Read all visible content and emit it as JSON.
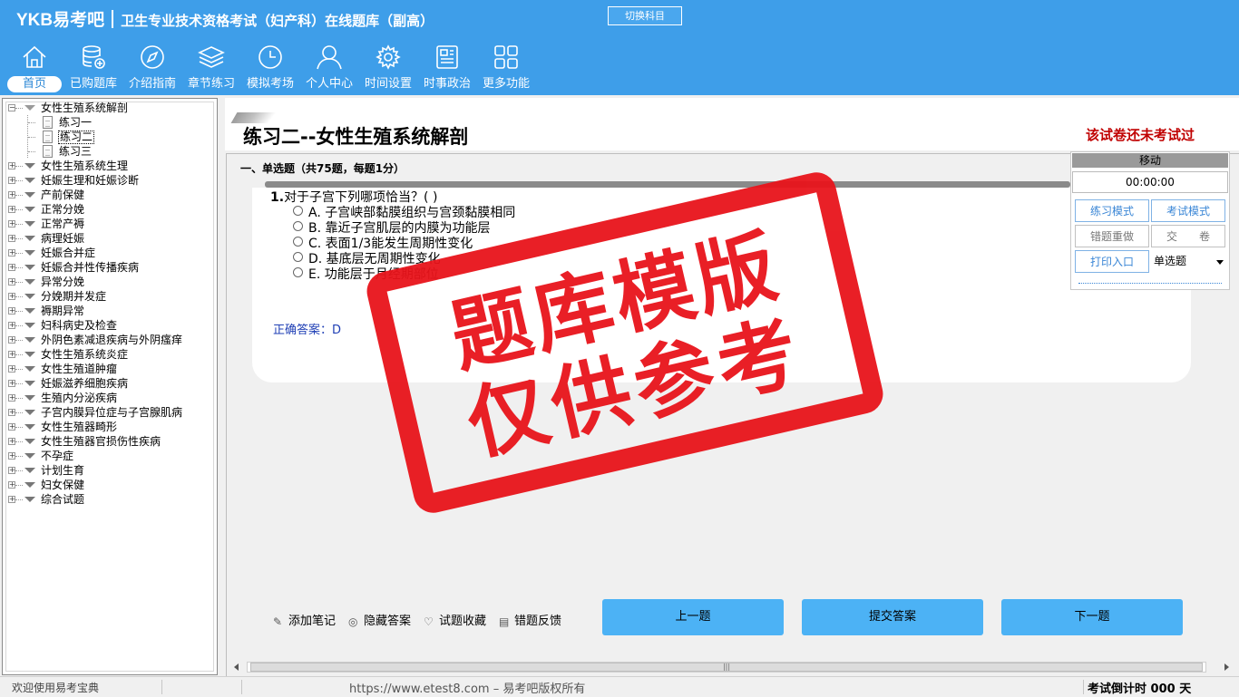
{
  "header": {
    "logo": "YKB易考吧",
    "title": "卫生专业技术资格考试（妇产科）在线题库（副高）",
    "switch_subject": "切换科目",
    "nav": [
      {
        "label": "首页",
        "icon": "home-icon"
      },
      {
        "label": "已购题库",
        "icon": "database-icon"
      },
      {
        "label": "介绍指南",
        "icon": "compass-icon"
      },
      {
        "label": "章节练习",
        "icon": "layers-icon"
      },
      {
        "label": "模拟考场",
        "icon": "clock-icon"
      },
      {
        "label": "个人中心",
        "icon": "user-icon"
      },
      {
        "label": "时间设置",
        "icon": "gear-icon"
      },
      {
        "label": "时事政治",
        "icon": "newspaper-icon"
      },
      {
        "label": "更多功能",
        "icon": "grid-icon"
      }
    ]
  },
  "tree": {
    "root": "女性生殖系统解剖",
    "children": [
      "练习一",
      "练习二",
      "练习三"
    ],
    "selected_child": "练习二",
    "items": [
      "女性生殖系统生理",
      "妊娠生理和妊娠诊断",
      "产前保健",
      "正常分娩",
      "正常产褥",
      "病理妊娠",
      "妊娠合并症",
      "妊娠合并性传播疾病",
      "异常分娩",
      "分娩期并发症",
      "褥期异常",
      "妇科病史及检查",
      "外阴色素减退疾病与外阴瘙痒",
      "女性生殖系统炎症",
      "女性生殖道肿瘤",
      "妊娠滋养细胞疾病",
      "生殖内分泌疾病",
      "子宫内膜异位症与子宫腺肌病",
      "女性生殖器畸形",
      "女性生殖器官损伤性疾病",
      "不孕症",
      "计划生育",
      "妇女保健",
      "综合试题"
    ]
  },
  "paper": {
    "title": "练习二--女性生殖系统解剖",
    "status": "该试卷还未考试过",
    "section": "一、单选题（共75题，每题1分）"
  },
  "question": {
    "number": "1.",
    "text": "对于子宫下列哪项恰当？( )",
    "options": [
      "A. 子宫峡部黏膜组织与宫颈黏膜相同",
      "B. 靠近子宫肌层的内膜为功能层",
      "C. 表面1/3能发生周期性变化",
      "D. 基底层无周期性变化",
      "E. 功能层于月经期部位"
    ],
    "answer": "正确答案：D"
  },
  "side_panel": {
    "move": "移动",
    "timer": "00:00:00",
    "practice_mode": "练习模式",
    "exam_mode": "考试模式",
    "redo_wrong": "错题重做",
    "submit_paper": "交　　卷",
    "print": "打印入口",
    "question_type": "单选题"
  },
  "tools": {
    "add_note": "添加笔记",
    "hide_answer": "隐藏答案",
    "favorite": "试题收藏",
    "feedback": "错题反馈"
  },
  "buttons": {
    "prev": "上一题",
    "submit": "提交答案",
    "next": "下一题"
  },
  "status_bar": {
    "welcome": "欢迎使用易考宝典",
    "copyright": "https://www.etest8.com – 易考吧版权所有",
    "countdown": "考试倒计时 000 天"
  },
  "watermark": {
    "line1": "题库模版",
    "line2": "仅供参考"
  },
  "colors": {
    "header_bg": "#3e9ee9",
    "button_blue": "#4cb2f5",
    "stamp_red": "#e8141b",
    "status_red": "#c00000",
    "answer_blue": "#1f3fb5"
  }
}
